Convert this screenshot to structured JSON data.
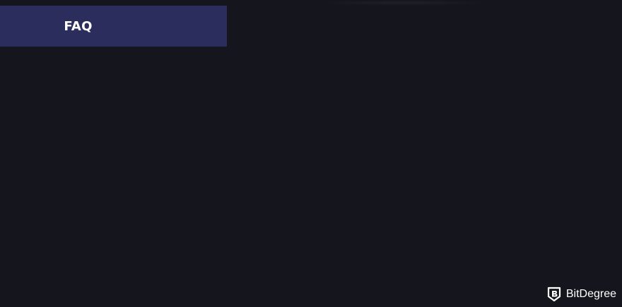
{
  "tabs": {
    "faq_label": "FAQ"
  },
  "watermark": {
    "brand": "BitDegree",
    "icon": "bitdegree-shield-icon"
  },
  "colors": {
    "background": "#15151e",
    "tab_background": "#2b2e5c",
    "text": "#ffffff"
  }
}
